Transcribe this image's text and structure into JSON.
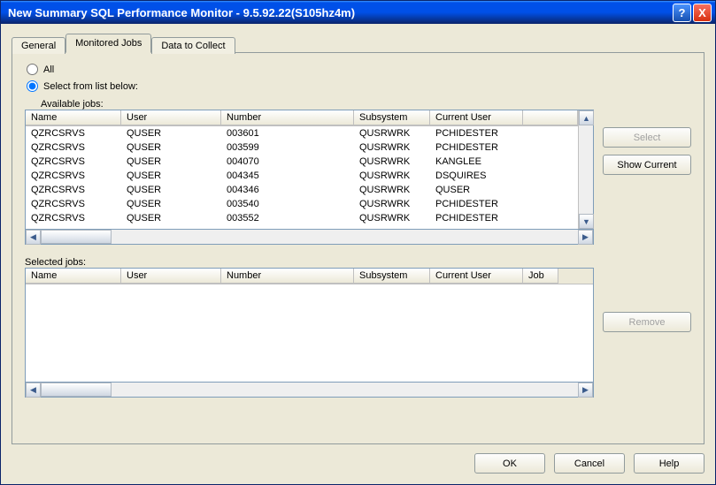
{
  "window": {
    "title": "New Summary SQL Performance Monitor - 9.5.92.22(S105hz4m)",
    "help_btn": "?",
    "close_btn": "X"
  },
  "tabs": {
    "general": "General",
    "monitored": "Monitored Jobs",
    "collect": "Data to Collect"
  },
  "radios": {
    "all": "All",
    "select": "Select from list below:"
  },
  "labels": {
    "available": "Available jobs:",
    "selected": "Selected jobs:"
  },
  "columns": {
    "name": "Name",
    "user": "User",
    "number": "Number",
    "subsystem": "Subsystem",
    "curuser": "Current User",
    "extra2": "Job"
  },
  "available_rows": [
    {
      "name": "QZRCSRVS",
      "user": "QUSER",
      "number": "003601",
      "subsystem": "QUSRWRK",
      "curuser": "PCHIDESTER"
    },
    {
      "name": "QZRCSRVS",
      "user": "QUSER",
      "number": "003599",
      "subsystem": "QUSRWRK",
      "curuser": "PCHIDESTER"
    },
    {
      "name": "QZRCSRVS",
      "user": "QUSER",
      "number": "004070",
      "subsystem": "QUSRWRK",
      "curuser": "KANGLEE"
    },
    {
      "name": "QZRCSRVS",
      "user": "QUSER",
      "number": "004345",
      "subsystem": "QUSRWRK",
      "curuser": "DSQUIRES"
    },
    {
      "name": "QZRCSRVS",
      "user": "QUSER",
      "number": "004346",
      "subsystem": "QUSRWRK",
      "curuser": "QUSER"
    },
    {
      "name": "QZRCSRVS",
      "user": "QUSER",
      "number": "003540",
      "subsystem": "QUSRWRK",
      "curuser": "PCHIDESTER"
    },
    {
      "name": "QZRCSRVS",
      "user": "QUSER",
      "number": "003552",
      "subsystem": "QUSRWRK",
      "curuser": "PCHIDESTER"
    }
  ],
  "side_buttons": {
    "select": "Select",
    "show_current": "Show Current",
    "remove": "Remove"
  },
  "bottom_buttons": {
    "ok": "OK",
    "cancel": "Cancel",
    "help": "Help"
  },
  "scroll_glyphs": {
    "up": "▲",
    "down": "▼",
    "left": "◀",
    "right": "▶"
  }
}
